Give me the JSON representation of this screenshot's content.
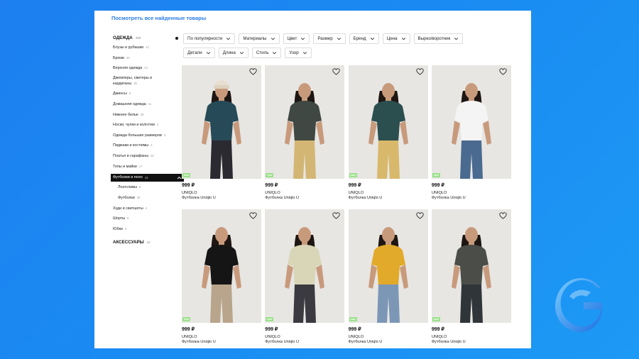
{
  "header": {
    "see_all": "Посмотреть все найденные товары"
  },
  "sidebar": {
    "category1": {
      "label": "ОДЕЖДА",
      "count": "390"
    },
    "items": [
      {
        "label": "Блузы и рубашки",
        "count": "14"
      },
      {
        "label": "Брюки",
        "count": "40"
      },
      {
        "label": "Верхняя одежда",
        "count": "44"
      },
      {
        "label": "Джемперы, свитеры и кардиганы",
        "count": "35"
      },
      {
        "label": "Джинсы",
        "count": "6"
      },
      {
        "label": "Домашняя одежда",
        "count": "11"
      },
      {
        "label": "Нижнее белье",
        "count": "29"
      },
      {
        "label": "Носки, чулки и колготки",
        "count": "2"
      },
      {
        "label": "Одежда больших размеров",
        "count": "3"
      },
      {
        "label": "Пиджаки и костюмы",
        "count": "3"
      },
      {
        "label": "Платья и сарафаны",
        "count": "23"
      },
      {
        "label": "Топы и майки",
        "count": "17"
      }
    ],
    "active": {
      "label": "Футболки и поло",
      "count": "43"
    },
    "subitems": [
      {
        "label": "Лонгсливы",
        "count": "6"
      },
      {
        "label": "Футболки",
        "count": "30"
      }
    ],
    "items2": [
      {
        "label": "Худи и свитшоты",
        "count": "4"
      },
      {
        "label": "Шорты",
        "count": "6"
      },
      {
        "label": "Юбки",
        "count": "3"
      }
    ],
    "category2": {
      "label": "АКСЕССУАРЫ",
      "count": "44"
    }
  },
  "filters": {
    "row1": [
      "По популярности",
      "Материалы",
      "Цвет",
      "Размер",
      "Бренд",
      "Цена",
      "Вырез/воротник"
    ],
    "row2": [
      "Детали",
      "Длина",
      "Стиль",
      "Узор"
    ]
  },
  "products": [
    {
      "price": "999 ₽",
      "brand": "UNIQLO",
      "model": "Футболка Uniqlo U",
      "badge": "new",
      "shirt": "#264a57",
      "bottom": "#2a2a30",
      "hat": true
    },
    {
      "price": "999 ₽",
      "brand": "UNIQLO",
      "model": "Футболка Uniqlo U",
      "badge": "new",
      "shirt": "#3f4842",
      "bottom": "#d3b674"
    },
    {
      "price": "999 ₽",
      "brand": "UNIQLO",
      "model": "Футболка Uniqlo U",
      "badge": "new",
      "shirt": "#2b4e4f",
      "bottom": "#d8b86a"
    },
    {
      "price": "999 ₽",
      "brand": "UNIQLO",
      "model": "Футболка Uniqlo U",
      "badge": "new",
      "shirt": "#f4f4f4",
      "bottom": "#4a6a90"
    },
    {
      "price": "999 ₽",
      "brand": "UNIQLO",
      "model": "Футболка Uniqlo U",
      "badge": "new",
      "shirt": "#151515",
      "bottom": "#b8a58c"
    },
    {
      "price": "999 ₽",
      "brand": "UNIQLO",
      "model": "Футболка Uniqlo U",
      "badge": "new",
      "shirt": "#d9d6b8",
      "bottom": "#3a3a40"
    },
    {
      "price": "999 ₽",
      "brand": "UNIQLO",
      "model": "Футболка Uniqlo U",
      "badge": "new",
      "shirt": "#e2aa2a",
      "bottom": "#7c97b6"
    },
    {
      "price": "999 ₽",
      "brand": "UNIQLO",
      "model": "Футболка Uniqlo U",
      "badge": "new",
      "shirt": "#4a4d48",
      "bottom": "#30353a"
    }
  ]
}
